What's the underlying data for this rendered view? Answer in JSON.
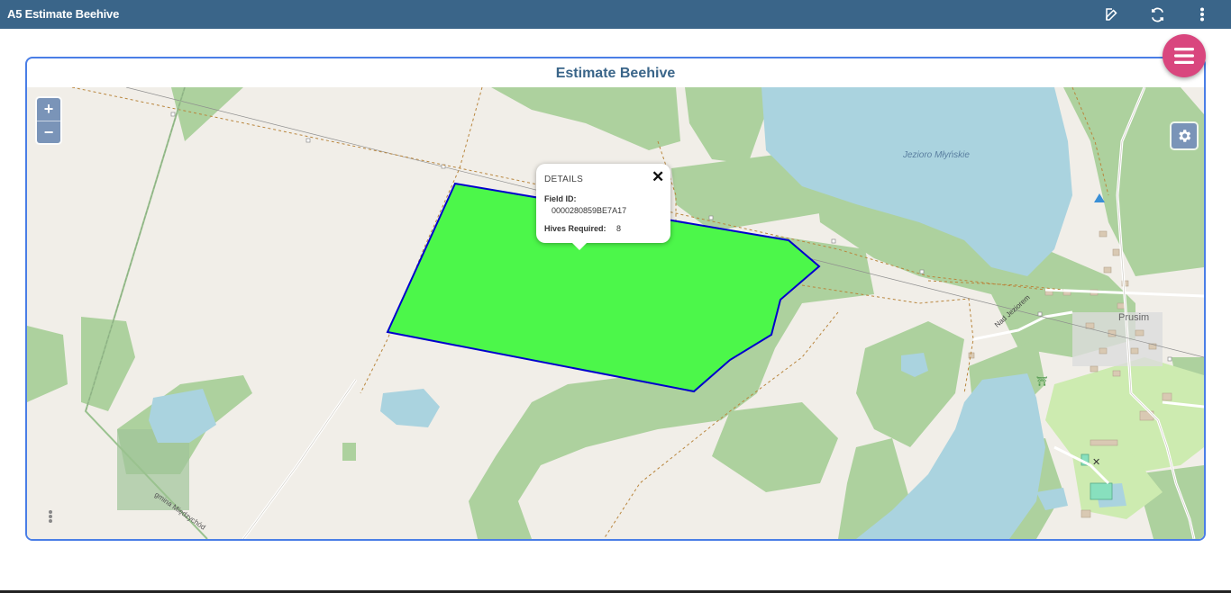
{
  "app": {
    "title": "A5 Estimate Beehive",
    "icons": [
      "edit-icon",
      "refresh-icon",
      "more-vertical-icon"
    ],
    "accent": "#3a6589",
    "fab_color": "#d9467e"
  },
  "card": {
    "title": "Estimate Beehive",
    "border_color": "#4a7ee6"
  },
  "map": {
    "zoom_in": "+",
    "zoom_out": "−",
    "field_fill": "#4cf74a",
    "field_stroke": "#0000cc",
    "labels": {
      "lake": "Jezioro Młyńskie",
      "town": "Prusim",
      "road": "Nad Jeziorem",
      "boundary": "gmina Międzychód"
    }
  },
  "popup": {
    "header": "DETAILS",
    "close": "✕",
    "field_id_label": "Field ID:",
    "field_id_value": "0000280859BE7A17",
    "hives_label": "Hives Required:",
    "hives_value": "8"
  }
}
